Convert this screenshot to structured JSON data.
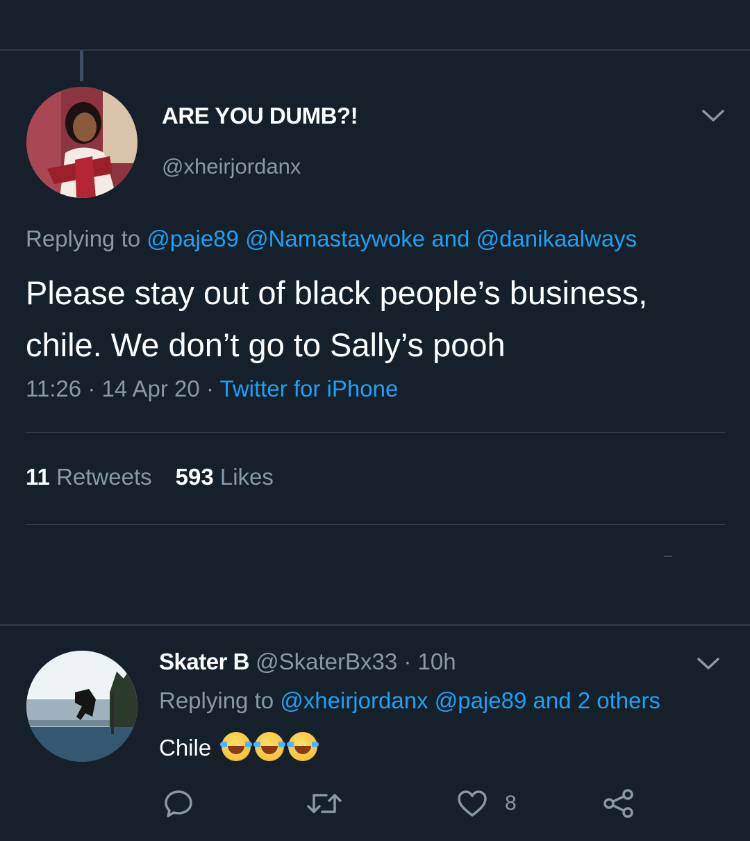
{
  "main_tweet": {
    "display_name": "ARE YOU DUMB?!",
    "handle": "@xheirjordanx",
    "replying_prefix": "Replying to",
    "replying_to": [
      "@paje89",
      "@Namastaywoke"
    ],
    "replying_and": "and",
    "replying_last": "@danikaalways",
    "text": "Please stay out of black people’s business, chile. We don’t go to Sally’s pooh",
    "time": "11:26",
    "date": "14 Apr 20",
    "separator": "·",
    "source": "Twitter for iPhone",
    "retweets_count": "11",
    "retweets_label": "Retweets",
    "likes_count": "593",
    "likes_label": "Likes"
  },
  "reply_tweet": {
    "display_name": "Skater B",
    "handle": "@SkaterBx33",
    "separator": "·",
    "age": "10h",
    "replying_prefix": "Replying to",
    "replying_to": [
      "@xheirjordanx",
      "@paje89"
    ],
    "replying_and": "and",
    "replying_others": "2 others",
    "text": "Chile",
    "emoji_count": 3,
    "like_count": "8"
  },
  "icons": {
    "more": "chevron-down-icon",
    "reply": "speech-bubble-icon",
    "retweet": "retweet-icon",
    "like": "heart-icon",
    "share": "share-icon"
  },
  "colors": {
    "background": "#15202b",
    "link": "#1da1f2",
    "secondary_text": "#8899a6",
    "divider": "#38444d"
  }
}
